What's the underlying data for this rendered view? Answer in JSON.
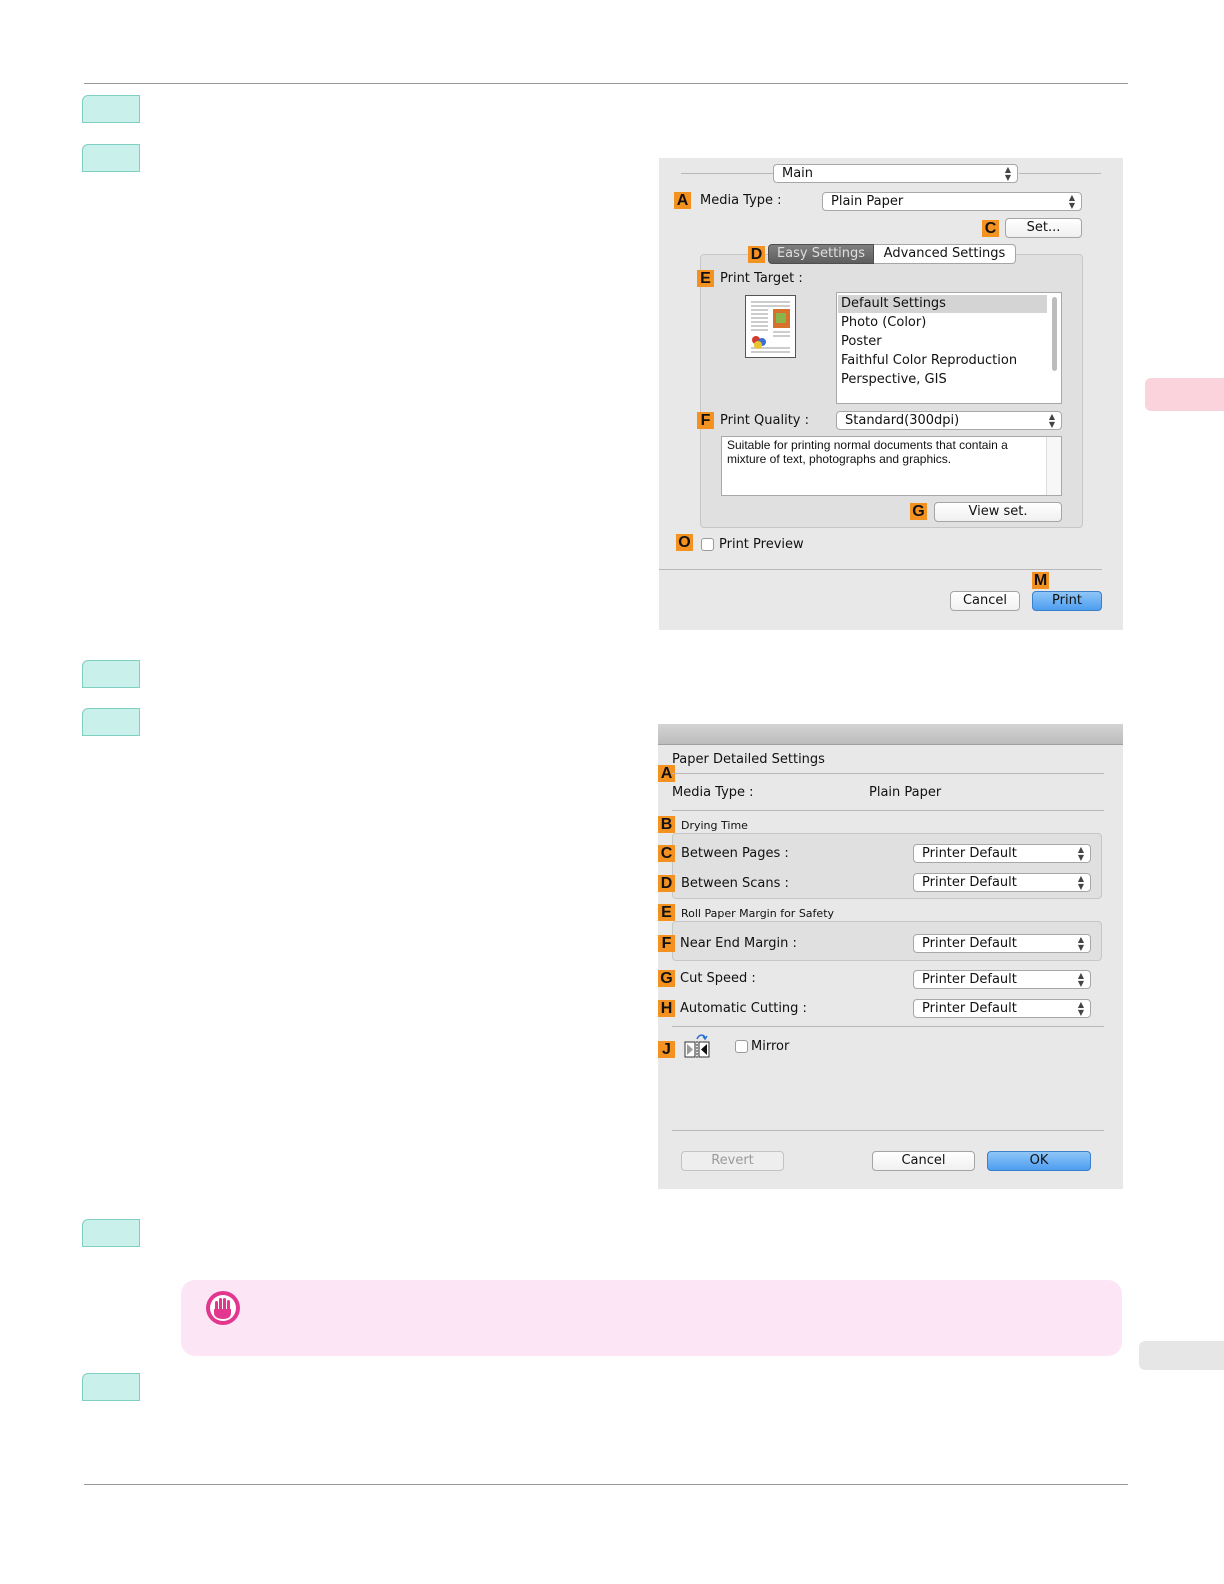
{
  "dialog1": {
    "panel_select": "Main",
    "markers": {
      "a": "A",
      "c": "C",
      "d": "D",
      "e": "E",
      "f": "F",
      "g": "G",
      "o": "O",
      "m": "M"
    },
    "media_type_label": "Media Type :",
    "media_type_value": "Plain Paper",
    "set_button": "Set...",
    "tabs": [
      "Easy Settings",
      "Advanced Settings"
    ],
    "print_target_label": "Print Target :",
    "print_targets": [
      "Default Settings",
      "Photo (Color)",
      "Poster",
      "Faithful Color Reproduction",
      "Perspective, GIS"
    ],
    "print_quality_label": "Print Quality :",
    "print_quality_value": "Standard(300dpi)",
    "description": "Suitable for printing normal documents that contain a mixture of text, photographs and graphics.",
    "view_set_button": "View set.",
    "print_preview_label": "Print Preview",
    "cancel_button": "Cancel",
    "print_button": "Print"
  },
  "dialog2": {
    "title": "Paper Detailed Settings",
    "markers": {
      "a": "A",
      "b": "B",
      "c": "C",
      "d": "D",
      "e": "E",
      "f": "F",
      "g": "G",
      "h": "H",
      "j": "J"
    },
    "media_type_label": "Media Type :",
    "media_type_value": "Plain Paper",
    "drying_time_heading": "Drying Time",
    "between_pages_label": "Between Pages :",
    "between_scans_label": "Between Scans :",
    "roll_margin_heading": "Roll Paper Margin for Safety",
    "near_end_margin_label": "Near End Margin :",
    "cut_speed_label": "Cut Speed :",
    "automatic_cutting_label": "Automatic Cutting :",
    "printer_default": "Printer Default",
    "mirror_label": "Mirror",
    "revert_button": "Revert",
    "cancel_button": "Cancel",
    "ok_button": "OK"
  },
  "colors": {
    "step_tab": "#c9f0ea",
    "marker": "#f39221",
    "note_bg": "#fce6f6",
    "important_icon": "#e2368f",
    "side_tab_pink": "#fbd3dd",
    "side_tab_gray": "#e6e6e6"
  },
  "icons": [
    "important-hand-icon",
    "mirror-icon",
    "document-preview-icon"
  ]
}
